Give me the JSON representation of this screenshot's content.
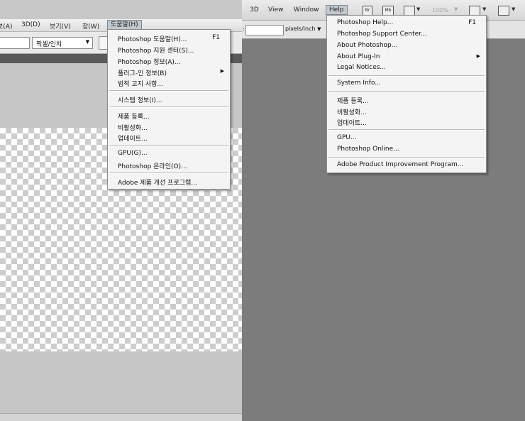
{
  "left_menubar": {
    "items": [
      "보(A)",
      "3D(D)",
      "보기(V)",
      "창(W)",
      "도움말(H)"
    ]
  },
  "left_options": {
    "unit_select": "픽셀/인치"
  },
  "help_menu_ko": {
    "items": [
      {
        "label": "Photoshop 도움말(H)...",
        "shortcut": "F1"
      },
      {
        "label": "Photoshop 지원 센터(S)..."
      },
      {
        "label": "Photoshop 정보(A)..."
      },
      {
        "label": "플러그-인 정보(B)",
        "submenu": true
      },
      {
        "label": "법적 고지 사항..."
      },
      {
        "label": "시스템 정보(I)..."
      },
      {
        "label": "제품 등록..."
      },
      {
        "label": "비활성화..."
      },
      {
        "label": "업데이트..."
      },
      {
        "label": "GPU(G)..."
      },
      {
        "label": "Photoshop 온라인(O)..."
      },
      {
        "label": "Adobe 제품 개선 프로그램..."
      }
    ]
  },
  "right_menubar": {
    "items": [
      "3D",
      "View",
      "Window",
      "Help"
    ],
    "zoom": "100%"
  },
  "right_options": {
    "resolution_unit": "pixels/inch",
    "label_colon": ":"
  },
  "toolbar_icons": {
    "bridge": "Br",
    "mini_bridge": "Mb"
  },
  "help_menu_en": {
    "items": [
      {
        "label": "Photoshop Help...",
        "shortcut": "F1"
      },
      {
        "label": "Photoshop Support Center..."
      },
      {
        "label": "About Photoshop..."
      },
      {
        "label": "About Plug-In",
        "submenu": true
      },
      {
        "label": "Legal Notices..."
      },
      {
        "label": "System Info..."
      },
      {
        "label": "제품 등록..."
      },
      {
        "label": "비활성화..."
      },
      {
        "label": "업데이트..."
      },
      {
        "label": "GPU..."
      },
      {
        "label": "Photoshop Online..."
      },
      {
        "label": "Adobe Product Improvement Program..."
      }
    ]
  },
  "colors": {
    "workspace": "#7c7c7c",
    "menu_bg": "#f4f4f4",
    "active_menu": "#c4c9cf"
  }
}
